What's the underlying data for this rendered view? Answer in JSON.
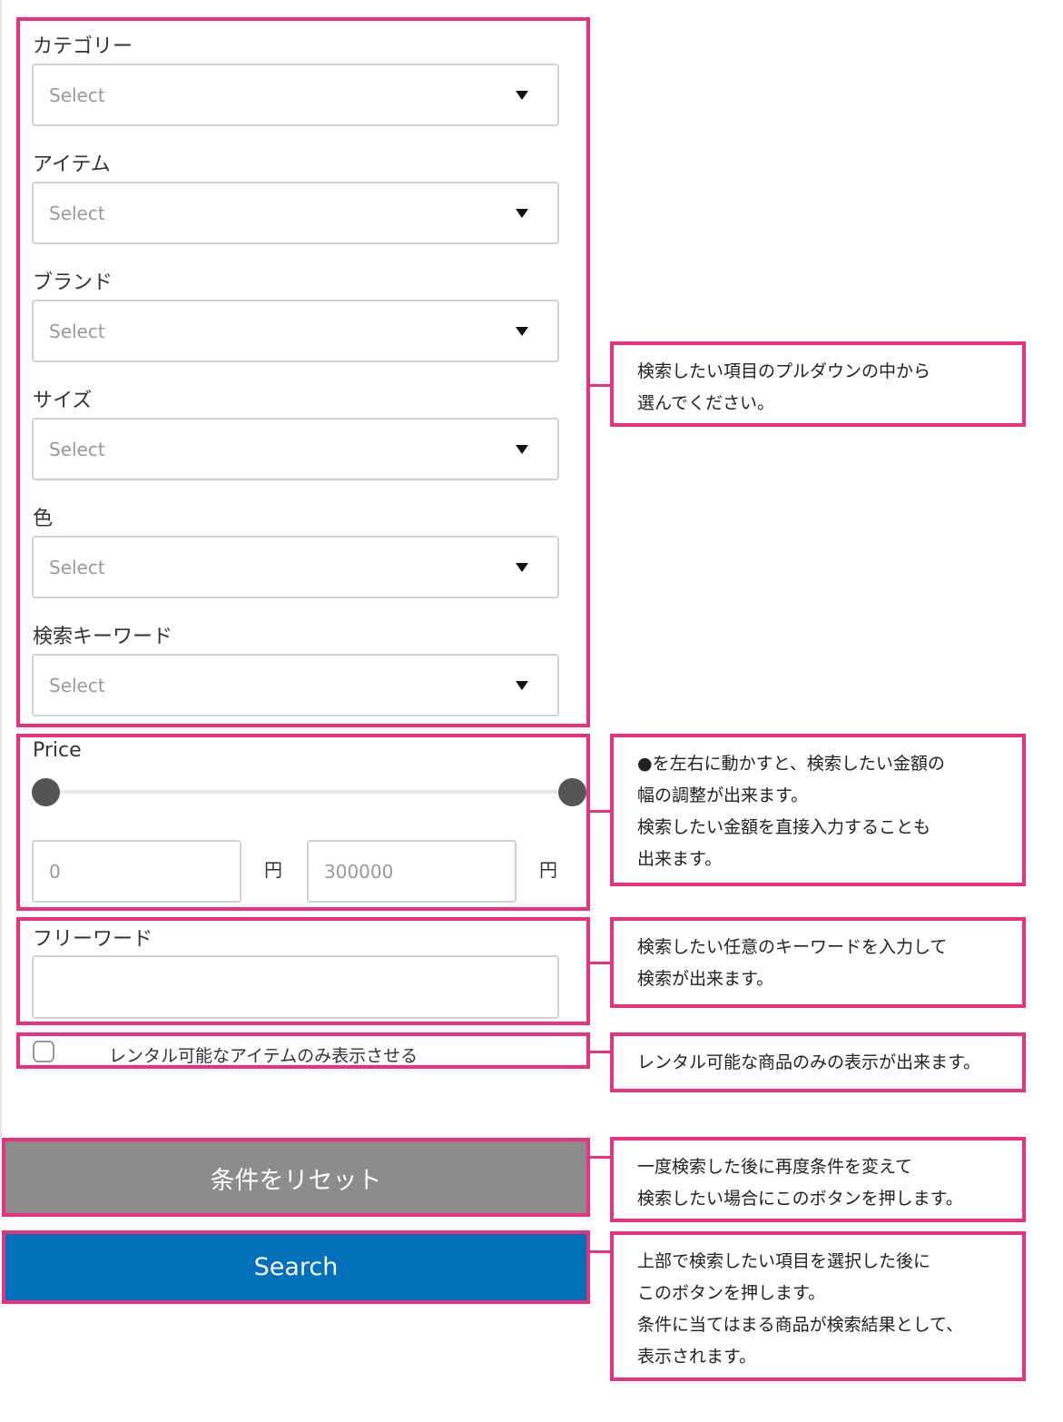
{
  "form": {
    "fields": [
      {
        "label": "カテゴリー",
        "placeholder": "Select"
      },
      {
        "label": "アイテム",
        "placeholder": "Select"
      },
      {
        "label": "ブランド",
        "placeholder": "Select"
      },
      {
        "label": "サイズ",
        "placeholder": "Select"
      },
      {
        "label": "色",
        "placeholder": "Select"
      },
      {
        "label": "検索キーワード",
        "placeholder": "Select"
      }
    ],
    "price": {
      "label": "Price",
      "min_value": "0",
      "max_value": "300000",
      "currency_unit": "円",
      "range_selected_fraction": [
        0,
        1
      ]
    },
    "free_word": {
      "label": "フリーワード",
      "value": ""
    },
    "rental_only": {
      "label": "レンタル可能なアイテムのみ表示させる",
      "checked": false
    },
    "reset_button": "条件をリセット",
    "search_button": "Search"
  },
  "annotations": {
    "dropdowns": [
      "検索したい項目のプルダウンの中から",
      "選んでください。"
    ],
    "price": [
      "●を左右に動かすと、検索したい金額の",
      "幅の調整が出来ます。",
      "検索したい金額を直接入力することも",
      "出来ます。"
    ],
    "free_word": [
      "検索したい任意のキーワードを入力して",
      "検索が出来ます。"
    ],
    "rental": [
      "レンタル可能な商品のみの表示が出来ます。"
    ],
    "reset": [
      "一度検索した後に再度条件を変えて",
      "検索したい場合にこのボタンを押します。"
    ],
    "search": [
      "上部で検索したい項目を選択した後に",
      "このボタンを押します。",
      "条件に当てはまる商品が検索結果として、",
      "表示されます。"
    ]
  },
  "colors": {
    "highlight": "#e8327f",
    "search_button": "#0070bb",
    "reset_button": "#8c8c8c"
  }
}
